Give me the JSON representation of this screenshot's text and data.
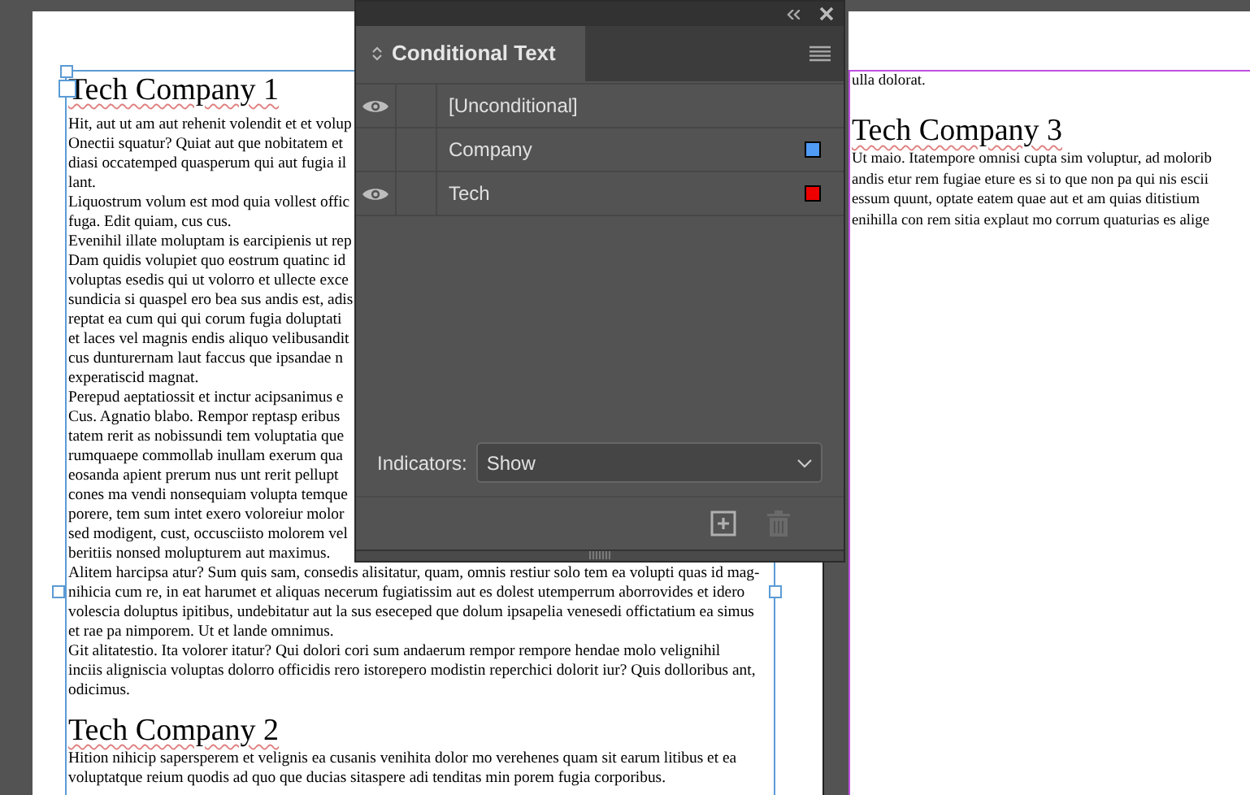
{
  "left_page": {
    "heading": "Tech Company 1",
    "lines": [
      "Hit, aut ut am aut rehenit volendit et et volup",
      "Onectii squatur? Quiat aut que nobitatem et",
      "diasi occatemped quasperum qui aut fugia il",
      "lant.",
      "Liquostrum volum est mod quia vollest offic",
      "fuga. Edit quiam, cus cus.",
      "Evenihil illate moluptam is earcipienis ut rep",
      "Dam quidis volupiet quo eostrum quatinc id",
      "voluptas esedis qui ut volorro et ullecte exce",
      "sundicia si quaspel ero bea sus andis est, adis",
      "reptat ea cum qui qui corum fugia doluptati",
      "et laces vel magnis endis aliquo velibusandit",
      "cus dunturernam laut faccus que ipsandae n",
      "experatiscid magnat.",
      "Perepud aeptatiossit et inctur acipsanimus e",
      "Cus. Agnatio blabo. Rempor reptasp eribus",
      "tatem rerit as nobissundi tem voluptatia que",
      "rumquaepe commollab inullam exerum qua",
      "eosanda apient prerum nus unt rerit pellupt",
      "cones ma vendi nonsequiam volupta temque",
      "porere, tem sum intet exero voloreiur molor",
      "sed modigent, cust, occusciisto molorem vel",
      "beritiis nonsed molupturem aut maximus.",
      "Alitem harcipsa atur? Sum quis sam, consedis alisitatur, quam, omnis restiur solo tem ea volupti quas id mag-",
      "nihicia cum re, in eat harumet et aliquas necerum fugiatissim aut es dolest utemperrum aborrovides et idero",
      "volescia doluptus ipitibus, undebitatur aut la sus eseceped que dolum ipsapelia venesedi offictatium ea simus",
      "et rae pa nimporem. Ut et lande omnimus.",
      "Git alitatestio. Ita volorer itatur? Qui dolori cori sum andaerum rempor rempore hendae molo velignihil",
      "inciis aligniscia voluptas dolorro officidis rero istorepero modistin reperchici dolorit iur? Quis dolloribus ant,",
      "odicimus."
    ],
    "heading_2": "Tech Company 2",
    "lines_2": [
      "Hition nihicip sapersperem et velignis ea cusanis venihita dolor mo verehenes quam sit earum litibus et ea",
      "voluptatque reium quodis ad quo que ducias sitaspere adi tenditas min porem fugia corporibus."
    ]
  },
  "right_page": {
    "lines_before": [
      "ulla dolorat."
    ],
    "heading": "Tech Company 3",
    "lines": [
      "Ut maio. Itatempore omnisi cupta sim voluptur, ad molorib",
      "andis etur rem fugiae eture es si to que non pa qui nis escii",
      "essum quunt, optate eatem quae aut et am quias ditistium",
      "enihilla con rem sitia explaut mo corrum quaturias es alige"
    ]
  },
  "panel": {
    "title": "Conditional Text",
    "conditions": [
      {
        "name": "[Unconditional]",
        "visible": true,
        "selected": false
      },
      {
        "name": "Company",
        "visible": false,
        "selected": false,
        "color": "#4f9bf5"
      },
      {
        "name": "Tech",
        "visible": true,
        "selected": false,
        "color": "#ee0000"
      }
    ],
    "indicators": {
      "label": "Indicators:",
      "value": "Show"
    },
    "footer_buttons": [
      {
        "kind": "new",
        "disabled": false
      },
      {
        "kind": "delete",
        "disabled": true
      }
    ]
  }
}
